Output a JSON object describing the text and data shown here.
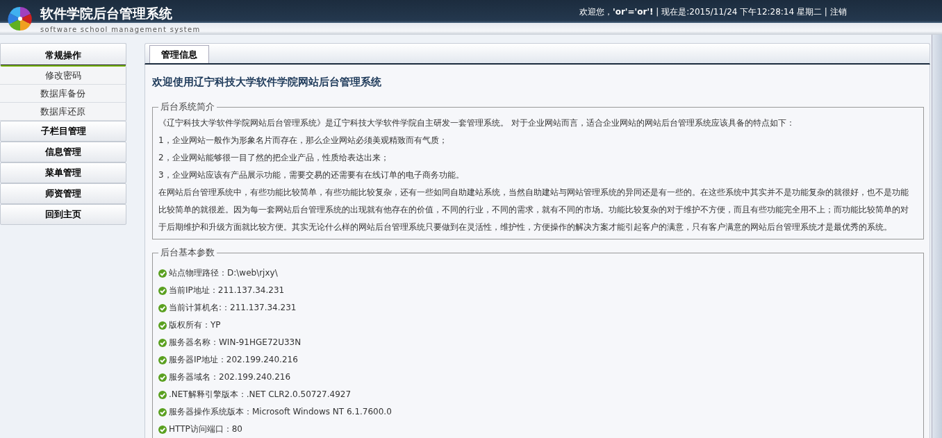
{
  "header": {
    "title": "软件学院后台管理系统",
    "subtitle": "software school management system",
    "greeting": "欢迎您，**'or'='or'!** | 现在是:2015/11/24 下午12:28:14 星期二 |",
    "logout": "注销"
  },
  "sidebar": {
    "groups": [
      {
        "label": "常规操作",
        "expanded": true,
        "children": [
          "修改密码",
          "数据库备份",
          "数据库还原"
        ]
      },
      {
        "label": "子栏目管理",
        "expanded": false
      },
      {
        "label": "信息管理",
        "expanded": false
      },
      {
        "label": "菜单管理",
        "expanded": false
      },
      {
        "label": "师资管理",
        "expanded": false
      },
      {
        "label": "回到主页",
        "expanded": false
      }
    ]
  },
  "tabs": [
    {
      "label": "管理信息",
      "selected": true
    }
  ],
  "heading": "欢迎使用辽宁科技大学软件学院网站后台管理系统",
  "sections": [
    {
      "kind": "text",
      "legend": "后台系统简介",
      "paragraphs": [
        "《辽宁科技大学软件学院网站后台管理系统》是辽宁科技大学软件学院自主研发一套管理系统。 对于企业网站而言，适合企业网站的网站后台管理系统应该具备的特点如下：",
        "1，企业网站一般作为形象名片而存在，那么企业网站必须美观精致而有气质；",
        "2，企业网站能够很一目了然的把企业产品，性质给表达出来；",
        "3，企业网站应该有产品展示功能，需要交易的还需要有在线订单的电子商务功能。",
        "在网站后台管理系统中，有些功能比较简单，有些功能比较复杂，还有一些如同自助建站系统，当然自助建站与网站管理系统的异同还是有一些的。在这些系统中其实并不是功能复杂的就很好，也不是功能比较简单的就很差。因为每一套网站后台管理系统的出现就有他存在的价值，不同的行业，不同的需求，就有不同的市场。功能比较复杂的对于维护不方便，而且有些功能完全用不上；而功能比较简单的对于后期维护和升级方面就比较方便。其实无论什么样的网站后台管理系统只要做到在灵活性，维护性，方便操作的解决方案才能引起客户的满意，只有客户满意的网站后台管理系统才是最优秀的系统。"
      ]
    },
    {
      "kind": "checklist",
      "legend": "后台基本参数",
      "items": [
        "站点物理路径：D:\\web\\rjxy\\",
        "当前IP地址：211.137.34.231",
        "当前计算机名:：211.137.34.231",
        "版权所有：YP",
        "服务器名称：WIN-91HGE72U33N",
        "服务器IP地址：202.199.240.216",
        "服务器域名：202.199.240.216",
        ".NET解释引擎版本：.NET CLR2.0.50727.4927",
        "服务器操作系统版本：Microsoft Windows NT 6.1.7600.0",
        "HTTP访问端口：80"
      ]
    }
  ]
}
